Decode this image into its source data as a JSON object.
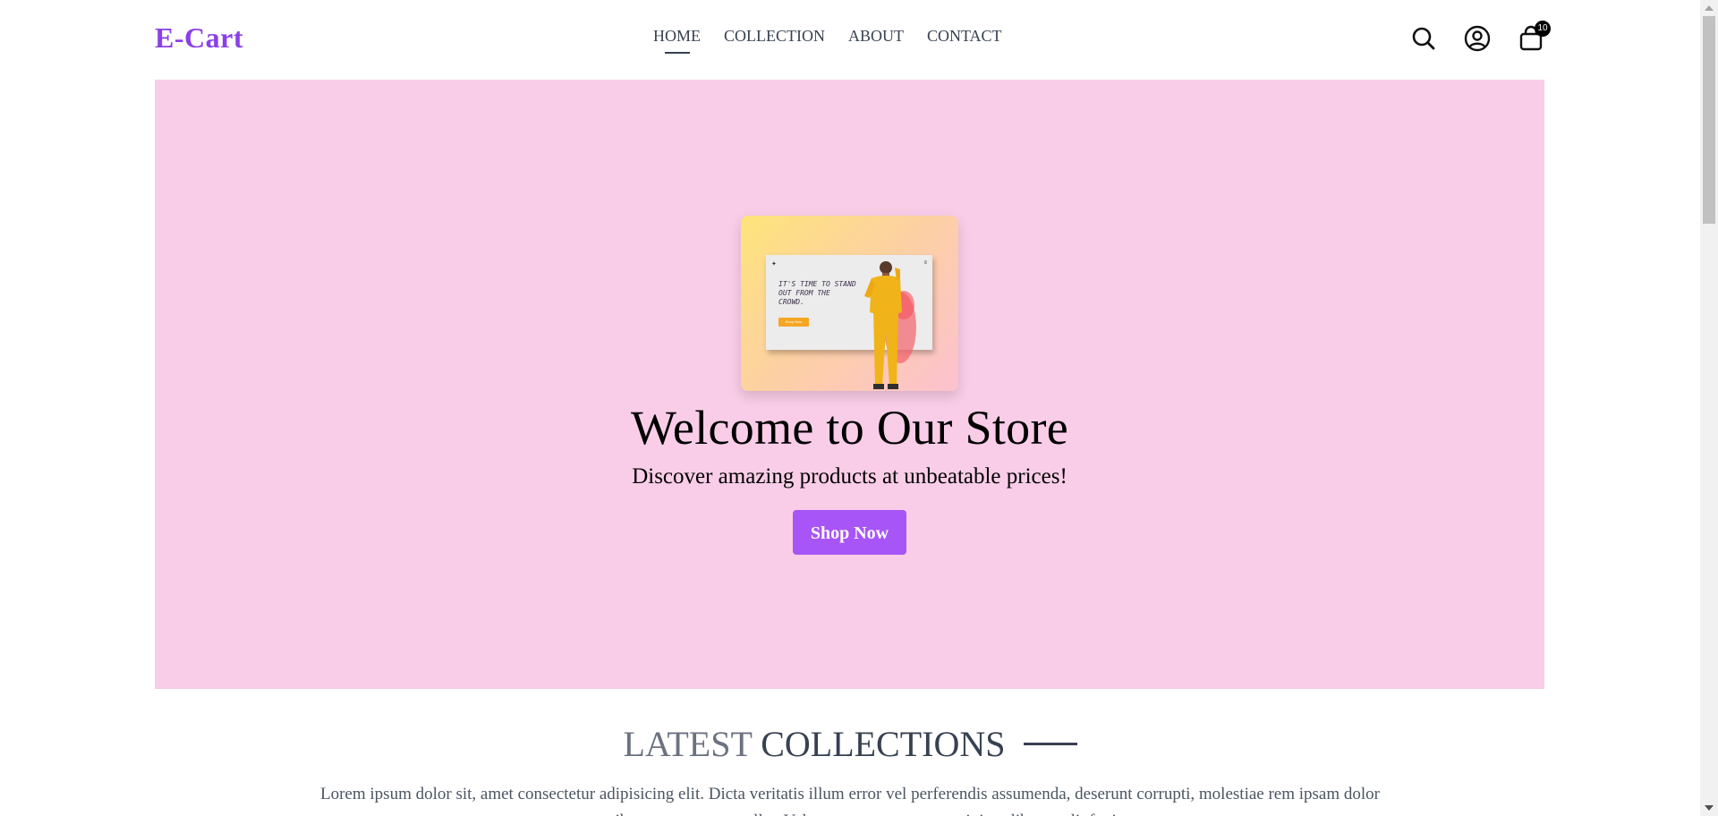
{
  "header": {
    "logo": "E-Cart",
    "nav": [
      {
        "label": "HOME",
        "active": true
      },
      {
        "label": "COLLECTION",
        "active": false
      },
      {
        "label": "ABOUT",
        "active": false
      },
      {
        "label": "CONTACT",
        "active": false
      }
    ],
    "icons": [
      "search-icon",
      "profile-icon",
      "cart-icon"
    ],
    "cart_count": "10"
  },
  "hero": {
    "background_color": "#f9cde7",
    "image": {
      "headline": "IT'S TIME TO STAND OUT FROM THE CROWD.",
      "button": "Shop Now"
    },
    "title": "Welcome to Our Store",
    "subtitle": "Discover amazing products at unbeatable prices!",
    "cta_label": "Shop Now",
    "cta_color": "#a855f7"
  },
  "latest_collections": {
    "title_part1": "LATEST",
    "title_part2": "COLLECTIONS",
    "description": "Lorem ipsum dolor sit, amet consectetur adipisicing elit. Dicta veritatis illum error vel perferendis assumenda, deserunt corrupti, molestiae rem ipsam dolor temporibus, numquam repellat. Voluptatem, amet excepturi, ipsa libero velit fugiat."
  },
  "colors": {
    "brand": "#8b3fe8",
    "nav_text": "#374151"
  }
}
